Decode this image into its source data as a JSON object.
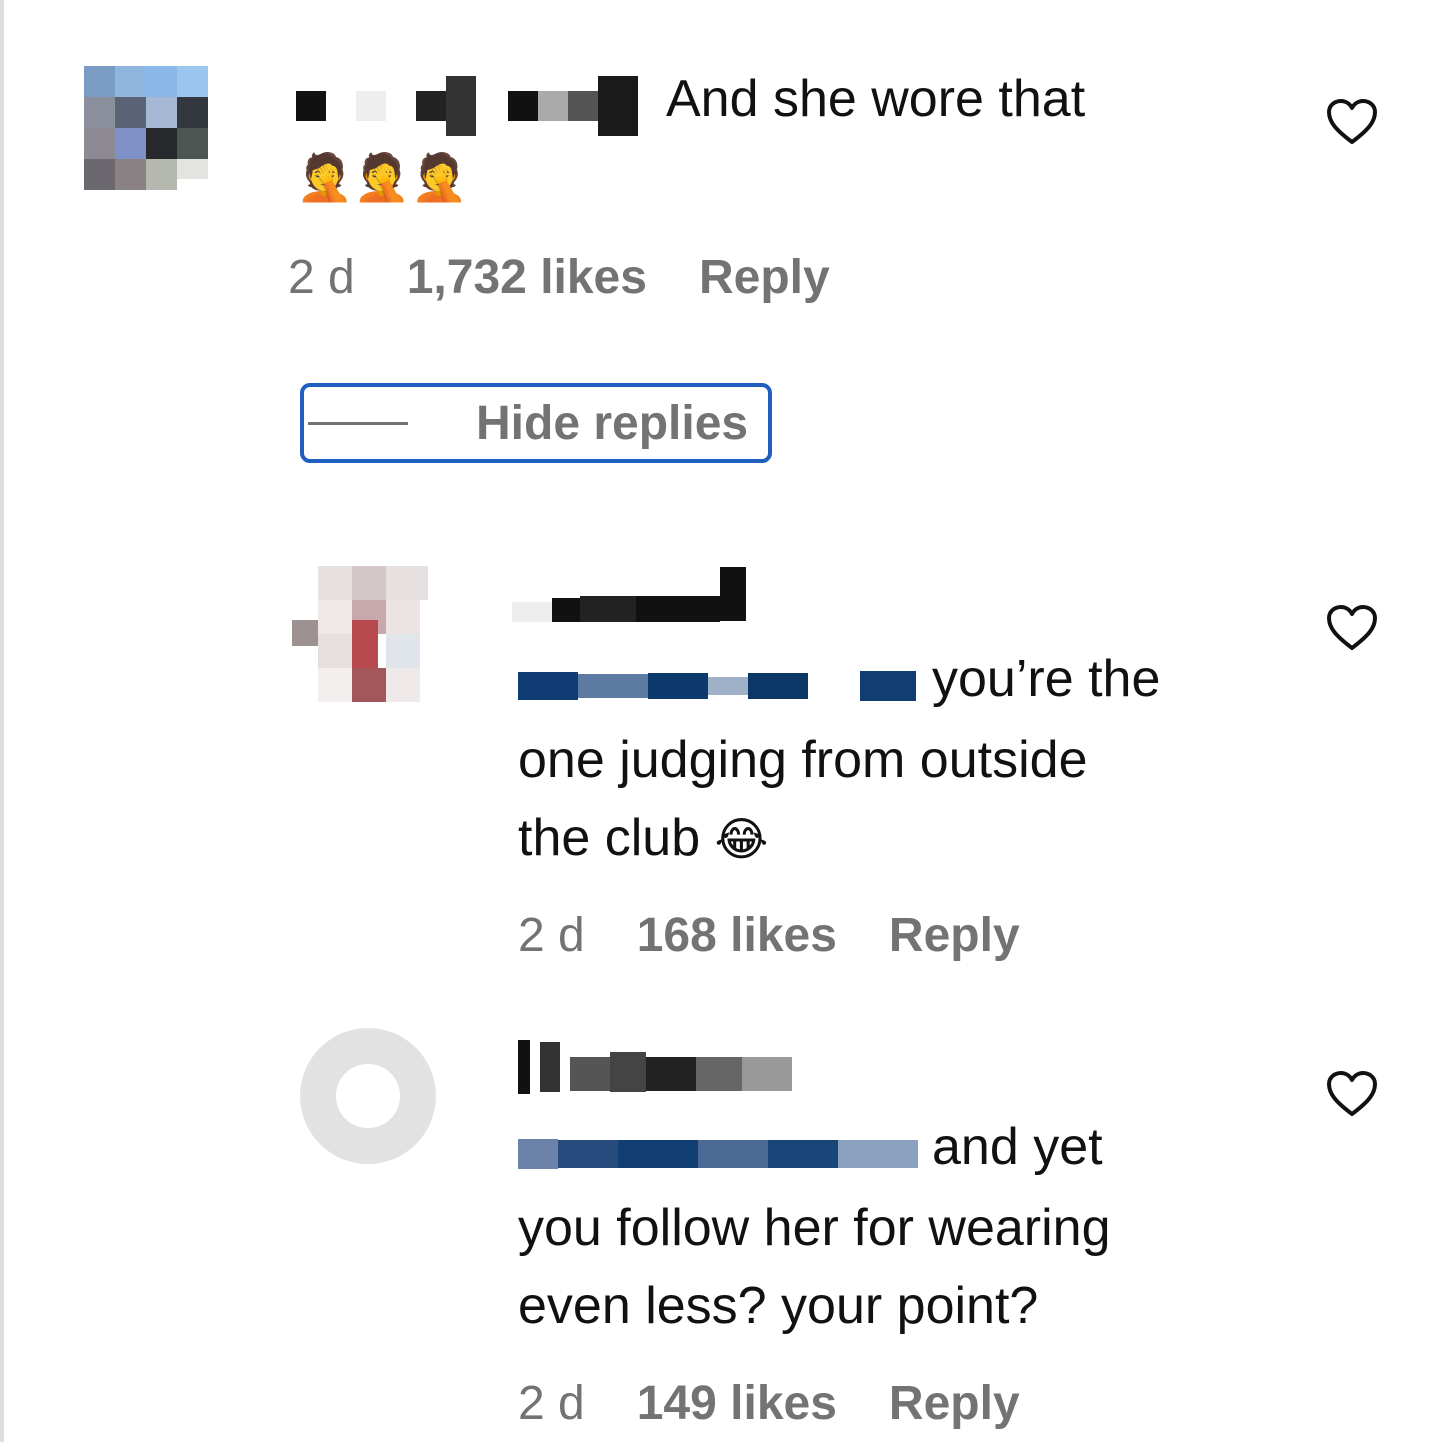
{
  "comments": [
    {
      "text": "And she wore that",
      "emoji": "🤦🤦🤦",
      "time": "2 d",
      "likes": "1,732 likes",
      "reply": "Reply"
    }
  ],
  "hide_replies_label": "Hide replies",
  "replies": [
    {
      "text_line1": "you’re the",
      "text_line2": "one judging from outside",
      "text_line3": "the club",
      "emoji": "😂",
      "time": "2 d",
      "likes": "168 likes",
      "reply": "Reply"
    },
    {
      "text_line1": "and yet",
      "text_line2": "you follow her for wearing",
      "text_line3": "even less? your point?",
      "time": "2 d",
      "likes": "149 likes",
      "reply": "Reply"
    }
  ],
  "colors": {
    "meta_gray": "#737373",
    "highlight_border": "#1f5fbf",
    "mention_blue": "#00376b"
  },
  "icons": [
    "heart-icon",
    "heart-icon",
    "heart-icon"
  ]
}
